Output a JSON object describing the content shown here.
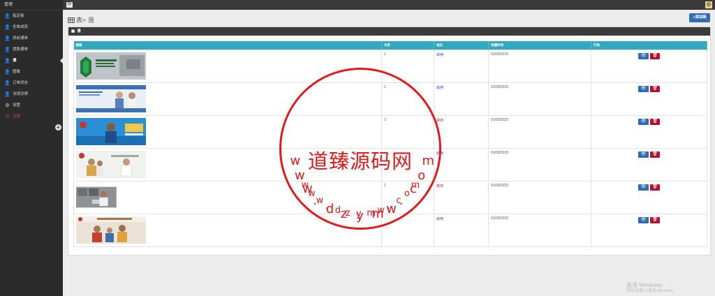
{
  "sidebar": {
    "title": "管理",
    "items": [
      {
        "label": "指定板",
        "icon": "user-icon"
      },
      {
        "label": "全体成员",
        "icon": "user-icon"
      },
      {
        "label": "烦前通单",
        "icon": "user-icon"
      },
      {
        "label": "提款通单",
        "icon": "user-icon"
      },
      {
        "label": "滑",
        "icon": "user-icon",
        "active": true
      },
      {
        "label": "图像",
        "icon": "user-icon"
      },
      {
        "label": "订单状态",
        "icon": "user-icon"
      },
      {
        "label": "法规法律",
        "icon": "user-icon"
      },
      {
        "label": "设置",
        "icon": "gear-icon"
      },
      {
        "label": "注销",
        "icon": "power-icon",
        "logout": true
      }
    ],
    "collapse_glyph": "+"
  },
  "topbar": {
    "refresh_glyph": "⟳",
    "settings_glyph": "⚙"
  },
  "page": {
    "breadcrumb": "表> 滑",
    "add_button": "+添加新"
  },
  "panel": {
    "title": "滑"
  },
  "table": {
    "headers": [
      "图像",
      "次序",
      "地位",
      "创建时间",
      "行动"
    ],
    "rows": [
      {
        "order": "1",
        "status": "启用",
        "status_on": true,
        "created": "01/03/2023"
      },
      {
        "order": "2",
        "status": "启用",
        "status_on": true,
        "created": "01/03/2023"
      },
      {
        "order": "2",
        "status": "禁用",
        "status_on": false,
        "created": "01/03/2023"
      },
      {
        "order": "",
        "status": "启用",
        "status_on": true,
        "created": "01/03/2023"
      },
      {
        "order": "2",
        "status": "禁用",
        "status_on": false,
        "created": "01/03/2023"
      },
      {
        "order": "",
        "status": "启用",
        "status_on": true,
        "created": "01/03/2023"
      }
    ],
    "view_glyph": "👁",
    "delete_glyph": "🗑"
  },
  "watermark": {
    "center": "道臻源码网",
    "top_arc": "w w w . d z y m w . c o m",
    "bottom_arc": "w w w . d z y m w . c o m"
  },
  "windows": {
    "title": "激活 Windows",
    "subtitle": "转到\"设置\"以激活 Windows。"
  },
  "colors": {
    "sidebar_bg": "#2b2b2b",
    "header_teal": "#33a9bf",
    "primary_blue": "#2f6db0",
    "danger_red": "#b5112e",
    "stamp_red": "#e21a1a"
  }
}
